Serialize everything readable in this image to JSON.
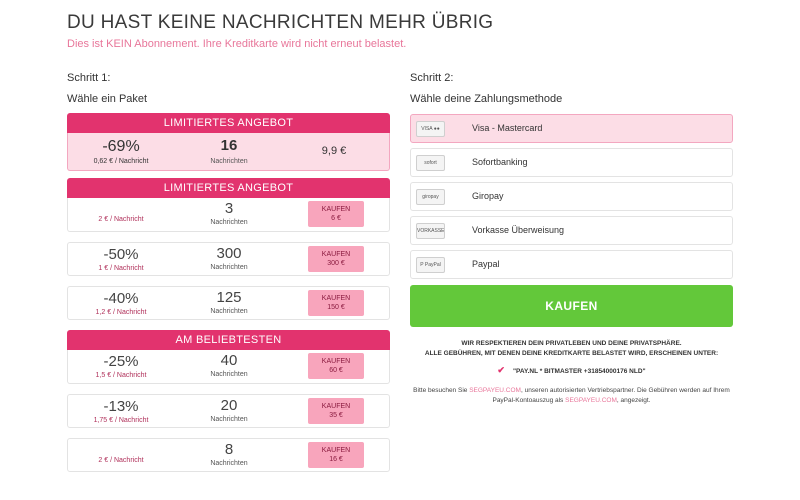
{
  "header": {
    "title": "DU HAST KEINE NACHRICHTEN MEHR ÜBRIG",
    "subtitle": "Dies ist KEIN Abonnement. Ihre Kreditkarte wird nicht erneut belastet."
  },
  "step1": {
    "heading": "Schritt 1:",
    "sub": "Wähle ein Paket"
  },
  "step2": {
    "heading": "Schritt 2:",
    "sub": "Wähle deine Zahlungsmethode"
  },
  "banners": {
    "limited_1": "LIMITIERTES ANGEBOT",
    "limited_2": "LIMITIERTES ANGEBOT",
    "popular": "AM BELIEBTESTEN"
  },
  "packages": [
    {
      "discount": "-69%",
      "per_msg": "0,62 € / Nachricht",
      "count": "16",
      "count_label": "Nachrichten",
      "price": "9,9 €"
    },
    {
      "discount": "",
      "per_msg": "2 € / Nachricht",
      "count": "3",
      "count_label": "Nachrichten",
      "buy_label": "KAUFEN",
      "buy_price": "6 €"
    },
    {
      "discount": "-50%",
      "per_msg": "1 € / Nachricht",
      "count": "300",
      "count_label": "Nachrichten",
      "buy_label": "KAUFEN",
      "buy_price": "300 €"
    },
    {
      "discount": "-40%",
      "per_msg": "1,2 € / Nachricht",
      "count": "125",
      "count_label": "Nachrichten",
      "buy_label": "KAUFEN",
      "buy_price": "150 €"
    },
    {
      "discount": "-25%",
      "per_msg": "1,5 € / Nachricht",
      "count": "40",
      "count_label": "Nachrichten",
      "buy_label": "KAUFEN",
      "buy_price": "60 €"
    },
    {
      "discount": "-13%",
      "per_msg": "1,75 € / Nachricht",
      "count": "20",
      "count_label": "Nachrichten",
      "buy_label": "KAUFEN",
      "buy_price": "35 €"
    },
    {
      "discount": "",
      "per_msg": "2 € / Nachricht",
      "count": "8",
      "count_label": "Nachrichten",
      "buy_label": "KAUFEN",
      "buy_price": "16 €"
    }
  ],
  "payment_methods": [
    {
      "label": "Visa - Mastercard",
      "logo_text": "VISA ●●",
      "icon": "visa-mastercard-logo"
    },
    {
      "label": "Sofortbanking",
      "logo_text": "sofort",
      "icon": "sofort-logo"
    },
    {
      "label": "Giropay",
      "logo_text": "giropay",
      "icon": "giropay-logo"
    },
    {
      "label": "Vorkasse Überweisung",
      "logo_text": "VORKASSE",
      "icon": "vorkasse-logo"
    },
    {
      "label": "Paypal",
      "logo_text": "P PayPal",
      "icon": "paypal-logo"
    }
  ],
  "checkout": {
    "button_label": "KAUFEN",
    "privacy_line1": "WIR RESPEKTIEREN DEIN PRIVATLEBEN UND DEINE PRIVATSPHÄRE.",
    "privacy_line2": "ALLE GEBÜHREN, MIT DENEN DEINE KREDITKARTE BELASTET WIRD, ERSCHEINEN UNTER:",
    "billing_name": "\"PAY.NL * BITMASTER +31854000176 NLD\"",
    "foot_1": "Bitte besuchen Sie ",
    "foot_link1": "SEGPAYEU.COM",
    "foot_2": ", unseren autorisierten Vertriebspartner. Die Gebühren werden auf Ihrem PayPal-Kontoauszug als ",
    "foot_link2": "SEGPAYEU.COM",
    "foot_3": ", angezeigt."
  },
  "colors": {
    "accent_pink": "#e2336e",
    "selected_bg": "#fcdde6",
    "buy_pink": "#f8a5bc",
    "kaufen_green": "#63c83a",
    "subtitle_pink": "#e8769a"
  }
}
